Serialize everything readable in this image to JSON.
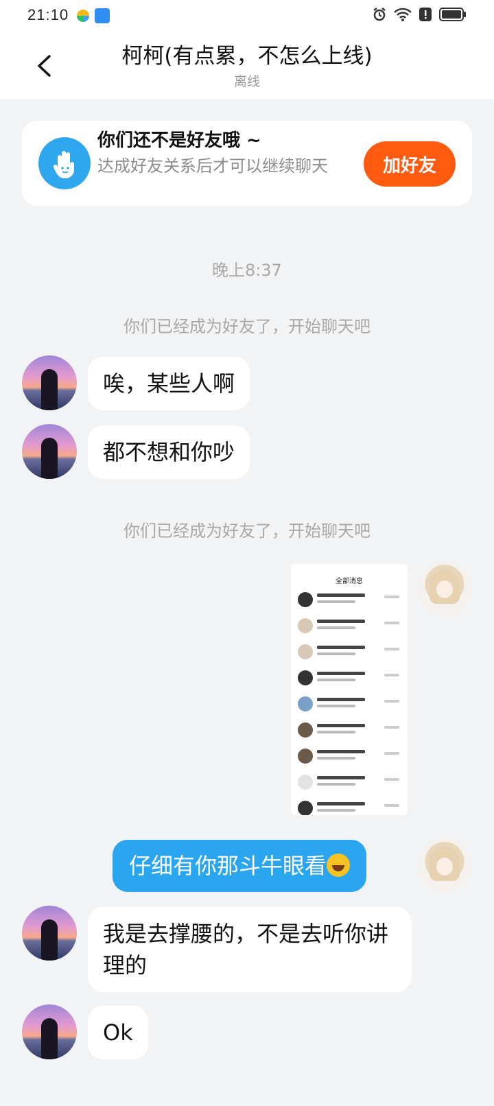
{
  "status_bar": {
    "time": "21:10"
  },
  "header": {
    "title": "柯柯(有点累，不怎么上线)",
    "subtitle": "离线"
  },
  "friend_card": {
    "title": "你们还不是好友哦 ~",
    "description": "达成好友关系后才可以继续聊天",
    "button_label": "加好友"
  },
  "chat": {
    "time_label": "晚上8:37",
    "system_note_1": "你们已经成为好友了，开始聊天吧",
    "msg_1": "唉，某些人啊",
    "msg_2": "都不想和你吵",
    "system_note_2": "你们已经成为好友了，开始聊天吧",
    "screenshot_header": "全部消息",
    "msg_sent": "仔细有你那斗牛眼看",
    "msg_3": "我是去撑腰的，不是去听你讲理的",
    "msg_4": "Ok"
  },
  "icons": {
    "back": "chevron-left-icon",
    "friend": "hand-icon",
    "emoji": "rofl-emoji-icon"
  },
  "colors": {
    "accent_blue": "#2aa5ef",
    "add_friend_orange": "#ff5a0f"
  }
}
